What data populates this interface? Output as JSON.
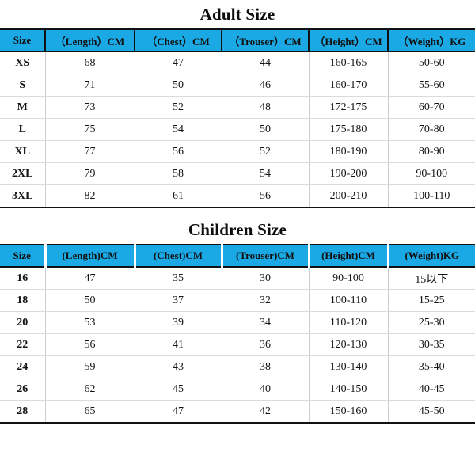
{
  "document": {
    "kind": "apparel-size-chart",
    "accent_color": "#1BA9E5",
    "text_color": "#151515",
    "background": "#FFFFFF"
  },
  "adult": {
    "title": "Adult Size",
    "columns": [
      "Size",
      "（Length）CM",
      "（Chest）CM",
      "（Trouser）CM",
      "（Height）CM",
      "（Weight）KG"
    ],
    "rows": [
      {
        "size": "XS",
        "length": "68",
        "chest": "47",
        "trouser": "44",
        "height": "160-165",
        "weight": "50-60"
      },
      {
        "size": "S",
        "length": "71",
        "chest": "50",
        "trouser": "46",
        "height": "160-170",
        "weight": "55-60"
      },
      {
        "size": "M",
        "length": "73",
        "chest": "52",
        "trouser": "48",
        "height": "172-175",
        "weight": "60-70"
      },
      {
        "size": "L",
        "length": "75",
        "chest": "54",
        "trouser": "50",
        "height": "175-180",
        "weight": "70-80"
      },
      {
        "size": "XL",
        "length": "77",
        "chest": "56",
        "trouser": "52",
        "height": "180-190",
        "weight": "80-90"
      },
      {
        "size": "2XL",
        "length": "79",
        "chest": "58",
        "trouser": "54",
        "height": "190-200",
        "weight": "90-100"
      },
      {
        "size": "3XL",
        "length": "82",
        "chest": "61",
        "trouser": "56",
        "height": "200-210",
        "weight": "100-110"
      }
    ]
  },
  "children": {
    "title": "Children Size",
    "columns": [
      "Size",
      "(Length)CM",
      "(Chest)CM",
      "(Trouser)CM",
      "(Height)CM",
      "(Weight)KG"
    ],
    "rows": [
      {
        "size": "16",
        "length": "47",
        "chest": "35",
        "trouser": "30",
        "height": "90-100",
        "weight": "15以下"
      },
      {
        "size": "18",
        "length": "50",
        "chest": "37",
        "trouser": "32",
        "height": "100-110",
        "weight": "15-25"
      },
      {
        "size": "20",
        "length": "53",
        "chest": "39",
        "trouser": "34",
        "height": "110-120",
        "weight": "25-30"
      },
      {
        "size": "22",
        "length": "56",
        "chest": "41",
        "trouser": "36",
        "height": "120-130",
        "weight": "30-35"
      },
      {
        "size": "24",
        "length": "59",
        "chest": "43",
        "trouser": "38",
        "height": "130-140",
        "weight": "35-40"
      },
      {
        "size": "26",
        "length": "62",
        "chest": "45",
        "trouser": "40",
        "height": "140-150",
        "weight": "40-45"
      },
      {
        "size": "28",
        "length": "65",
        "chest": "47",
        "trouser": "42",
        "height": "150-160",
        "weight": "45-50"
      }
    ]
  }
}
